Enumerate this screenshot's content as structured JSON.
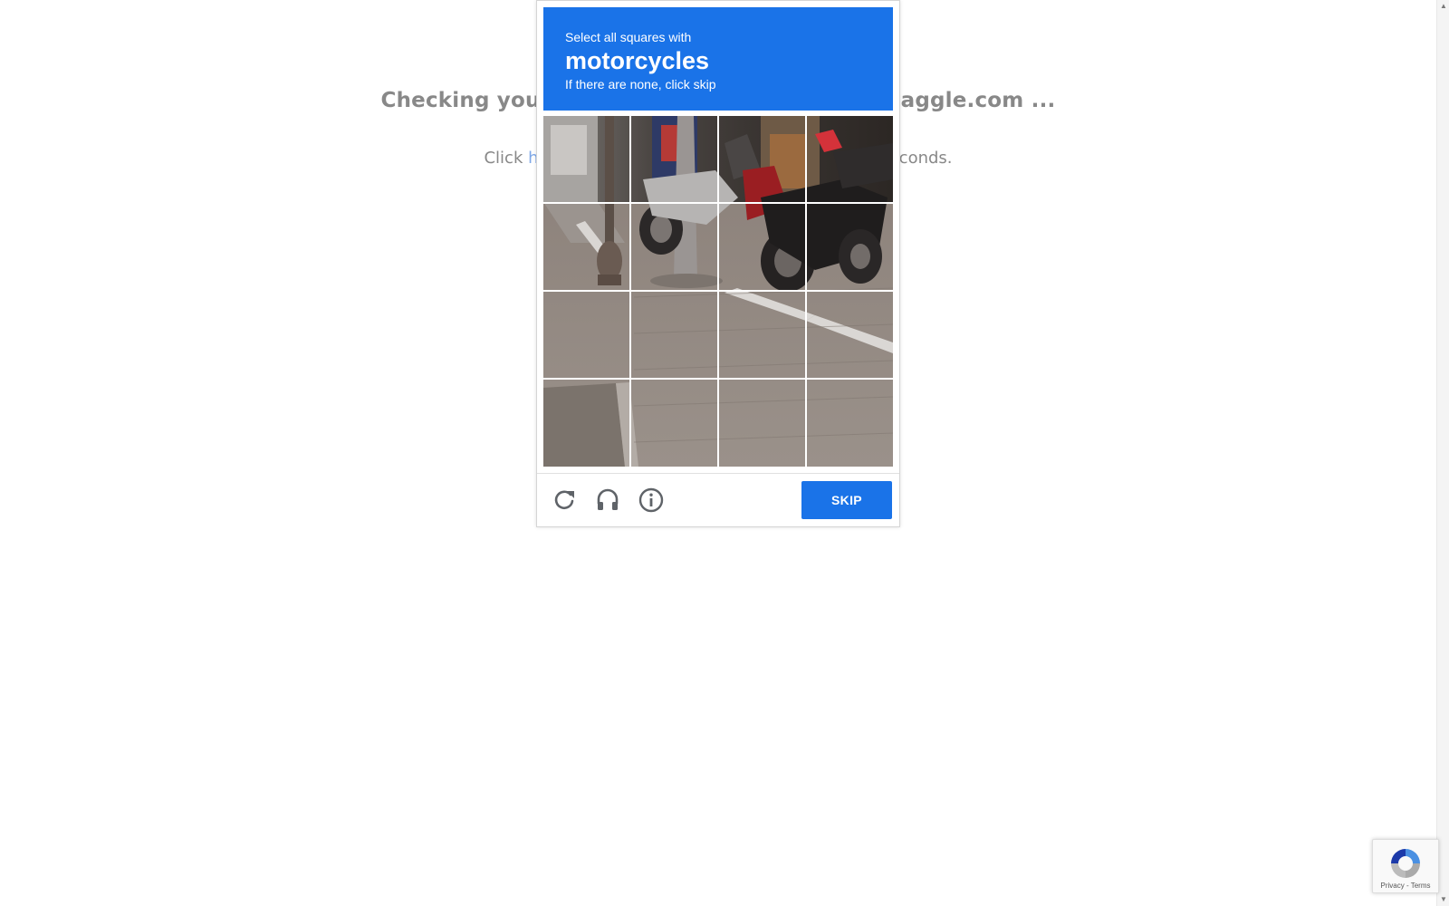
{
  "background_page": {
    "heading_left": "Checking you",
    "heading_right": "aggle.com ...",
    "line_click": "Click",
    "line_link": "he",
    "line_right": "econds."
  },
  "captcha": {
    "header": {
      "instruction": "Select all squares with",
      "target": "motorcycles",
      "hint": "If there are none, click skip"
    },
    "grid": {
      "rows": 4,
      "cols": 4,
      "selected_tiles": []
    },
    "footer": {
      "reload_icon": "reload-icon",
      "audio_icon": "headphones-icon",
      "info_icon": "info-icon",
      "skip_label": "SKIP"
    }
  },
  "recaptcha_badge": {
    "privacy": "Privacy",
    "separator": " - ",
    "terms": "Terms"
  },
  "colors": {
    "accent": "#1a73e8",
    "muted_text": "#888888",
    "link": "#7ea8e8"
  }
}
